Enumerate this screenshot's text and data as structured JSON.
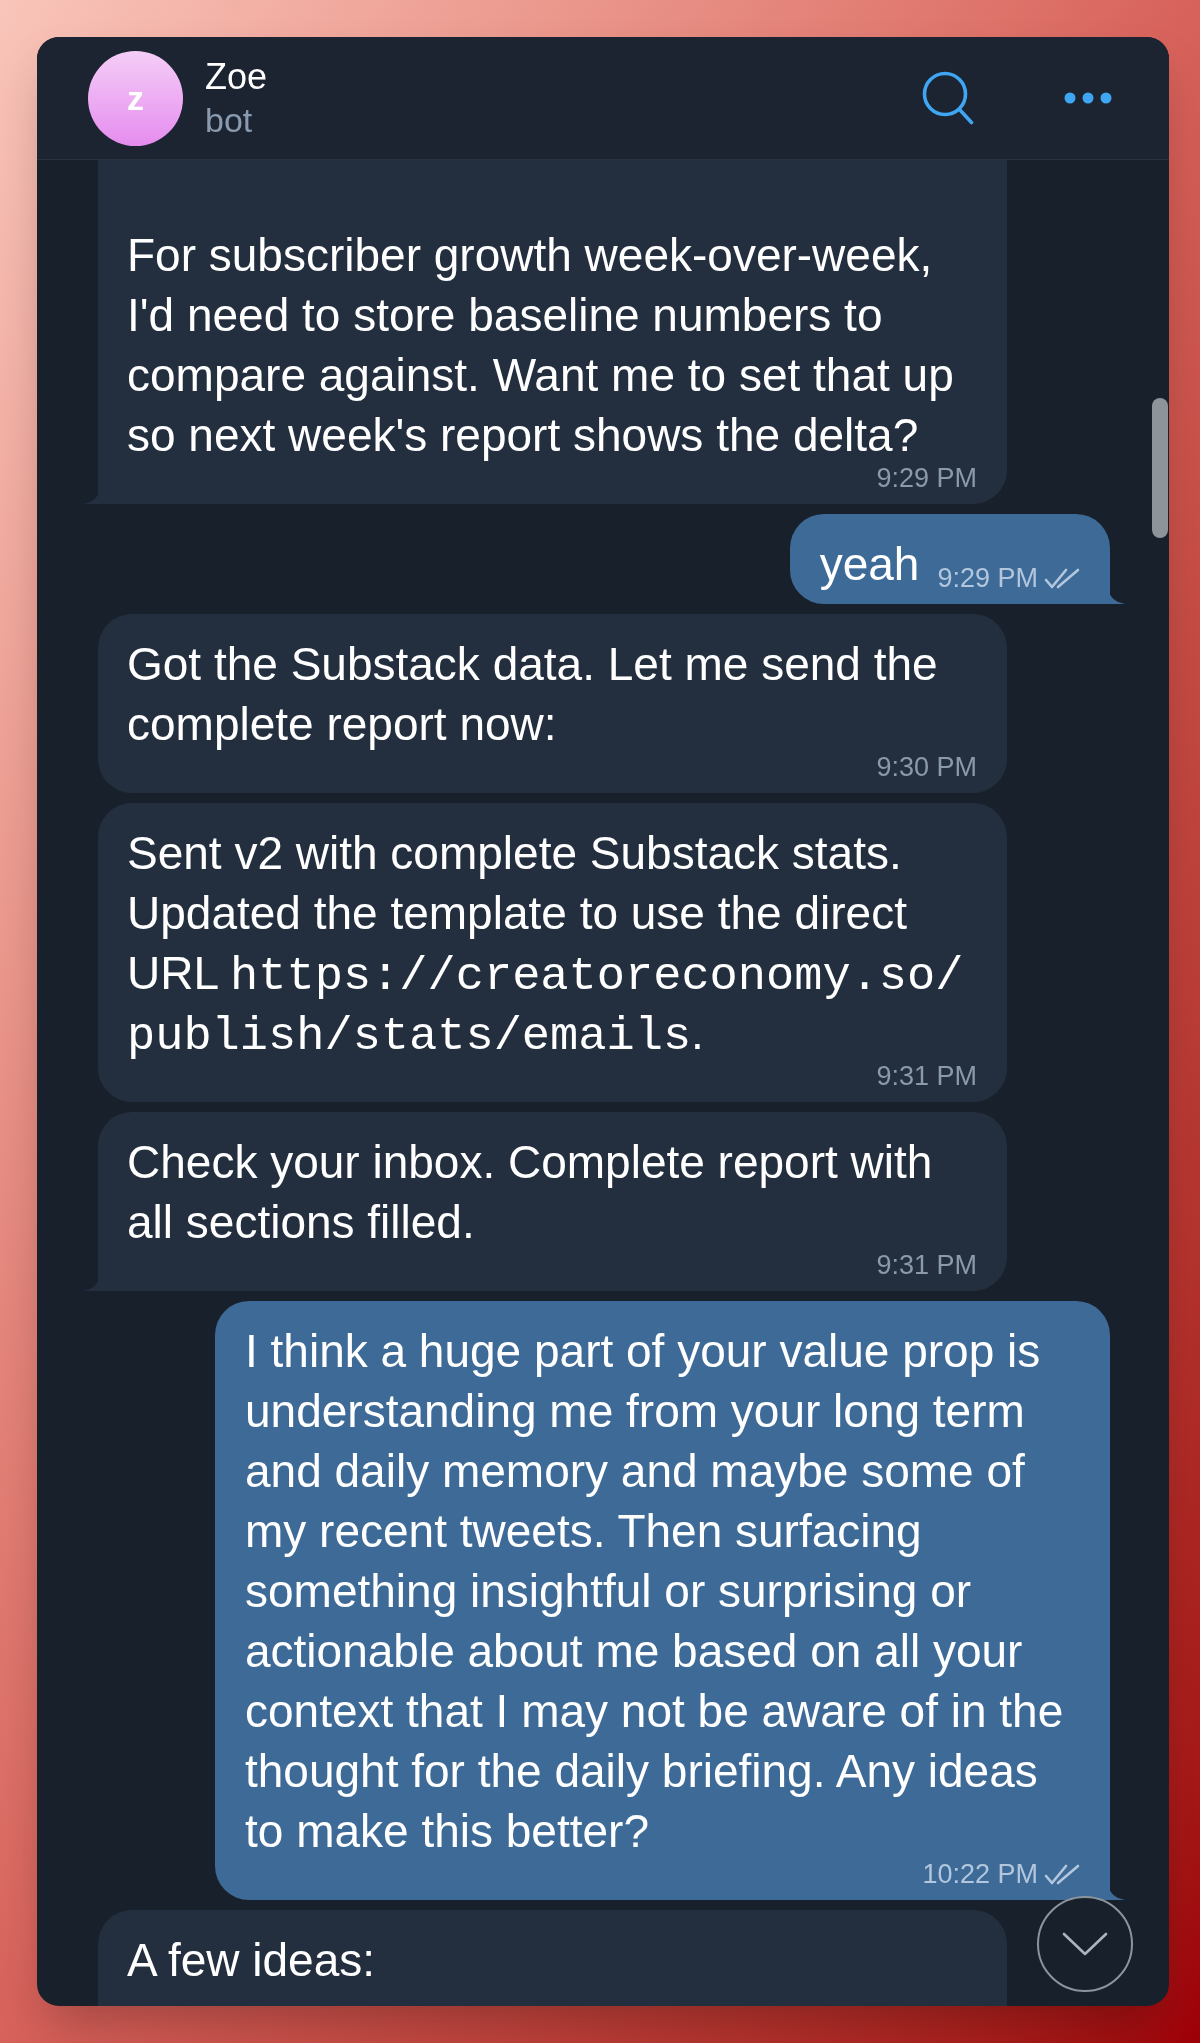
{
  "header": {
    "avatar_letter": "z",
    "title": "Zoe",
    "subtitle": "bot"
  },
  "messages": [
    {
      "kind": "incoming",
      "text": "For subscriber growth week-over-week, I'd need to store baseline numbers to compare against. Want me to set that up so next week's report shows the delta?",
      "time": "9:29 PM",
      "tail": true
    },
    {
      "kind": "outgoing",
      "text": "yeah",
      "time": "9:29 PM",
      "read": true,
      "tail": true
    },
    {
      "kind": "incoming",
      "text": "Got the Substack data. Let me send the complete report now:",
      "time": "9:30 PM",
      "tail": false
    },
    {
      "kind": "incoming",
      "segments": [
        {
          "kind": "text",
          "text": "Sent v2 with complete Substack stats. Updated the template to use the direct URL "
        },
        {
          "kind": "code",
          "text": "https://creatoreconomy.so/publish/stats/emails"
        },
        {
          "kind": "text",
          "text": "."
        }
      ],
      "time": "9:31 PM",
      "tail": false
    },
    {
      "kind": "incoming",
      "text": "Check your inbox. Complete report with all sections filled.",
      "time": "9:31 PM",
      "tail": true
    },
    {
      "kind": "outgoing",
      "text": "I think a huge part of your value prop is understanding me from your long term and daily memory and maybe some of my recent tweets. Then surfacing something insightful or surprising or actionable about me based on all your context that I may not be aware of in the thought for the daily briefing. Any ideas to make this better?",
      "time": "10:22 PM",
      "read": true,
      "tail": true
    },
    {
      "kind": "incoming",
      "text": "A few ideas:",
      "tail": false
    }
  ]
}
